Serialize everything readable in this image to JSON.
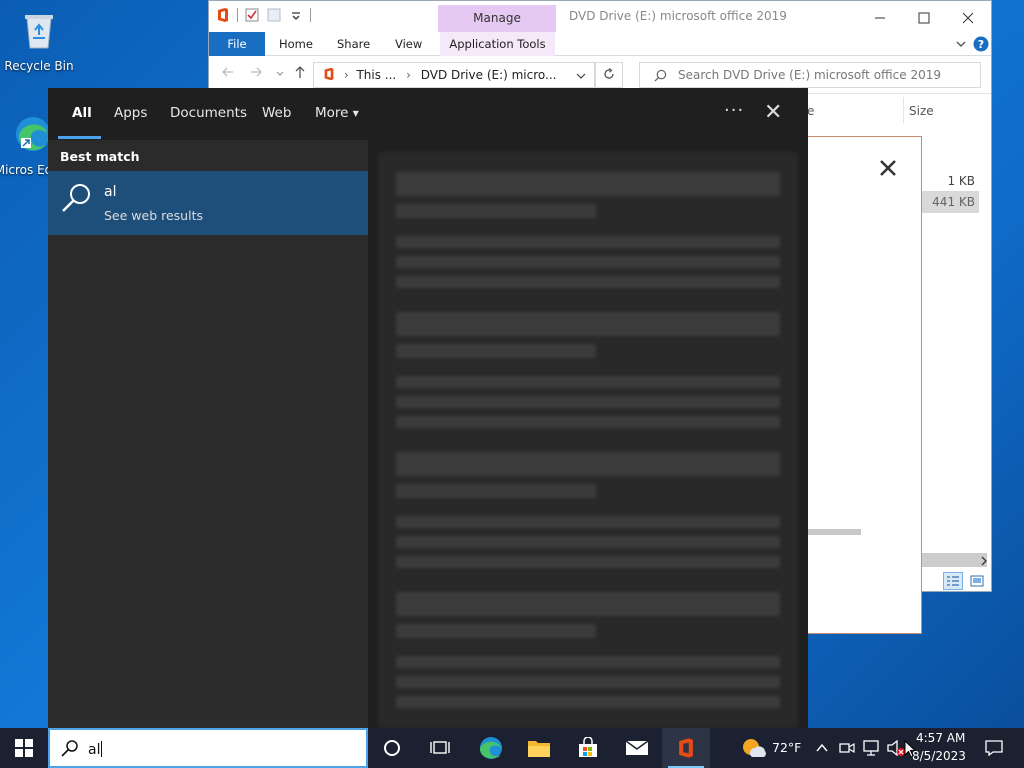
{
  "desktop": {
    "icons": [
      {
        "label": "Recycle Bin"
      },
      {
        "label": "Micros Edge"
      }
    ]
  },
  "explorer": {
    "manage_tab": "Manage",
    "title": "DVD Drive (E:) microsoft office 2019",
    "ribbon_tabs": [
      "File",
      "Home",
      "Share",
      "View",
      "Application Tools"
    ],
    "address": {
      "crumbs": [
        "This ...",
        "DVD Drive (E:) micro..."
      ]
    },
    "search_placeholder": "Search DVD Drive (E:) microsoft office 2019",
    "columns": {
      "name_partial": "e",
      "size": "Size"
    },
    "sizes": [
      "1 KB",
      "441 KB"
    ]
  },
  "search_panel": {
    "tabs": [
      "All",
      "Apps",
      "Documents",
      "Web",
      "More"
    ],
    "more_chevron": "▾",
    "ellipsis": "···",
    "close": "✕",
    "section_label": "Best match",
    "result": {
      "title": "al",
      "subtitle": "See web results"
    }
  },
  "taskbar": {
    "search_query": "al",
    "weather": "72°F",
    "time": "4:57 AM",
    "date": "8/5/2023"
  },
  "colors": {
    "accent": "#4ba3ec",
    "selected_result": "#1e4e7a",
    "panel_bg": "#1f1f1f",
    "taskbar_bg": "#1b2130"
  }
}
